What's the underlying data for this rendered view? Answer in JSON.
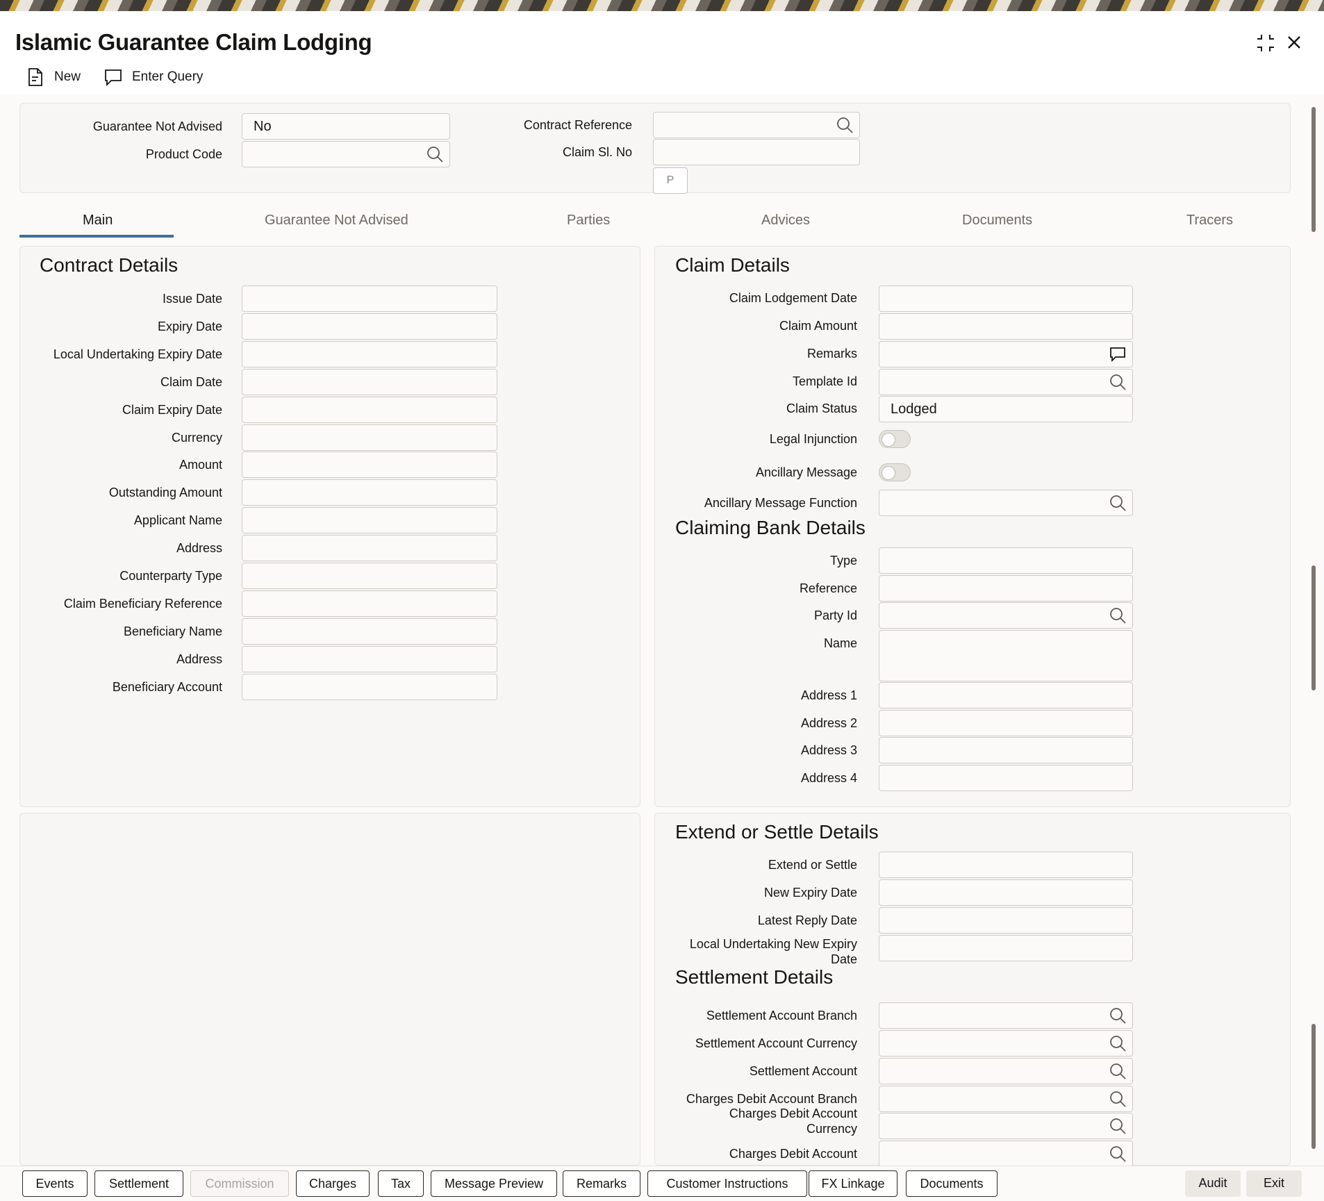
{
  "window": {
    "title": "Islamic Guarantee Claim Lodging"
  },
  "toolbar": {
    "new_label": "New",
    "enter_query_label": "Enter Query"
  },
  "header": {
    "guarantee_not_advised_label": "Guarantee Not Advised",
    "guarantee_not_advised_value": "No",
    "product_code_label": "Product Code",
    "contract_reference_label": "Contract Reference",
    "claim_sl_no_label": "Claim Sl. No",
    "p_button": "P"
  },
  "tabs": [
    "Main",
    "Guarantee Not Advised",
    "Parties",
    "Advices",
    "Documents",
    "Tracers"
  ],
  "contract_details": {
    "title": "Contract Details",
    "fields": [
      "Issue Date",
      "Expiry Date",
      "Local Undertaking Expiry Date",
      "Claim Date",
      "Claim Expiry Date",
      "Currency",
      "Amount",
      "Outstanding Amount",
      "Applicant Name",
      "Address",
      "Counterparty Type",
      "Claim Beneficiary Reference",
      "Beneficiary Name",
      "Address",
      "Beneficiary Account"
    ]
  },
  "claim_details": {
    "title": "Claim Details",
    "claim_lodgement_date": "Claim Lodgement Date",
    "claim_amount": "Claim Amount",
    "remarks": "Remarks",
    "template_id": "Template Id",
    "claim_status": "Claim Status",
    "claim_status_value": "Lodged",
    "legal_injunction": "Legal Injunction",
    "ancillary_message": "Ancillary Message",
    "ancillary_message_function": "Ancillary Message Function"
  },
  "claiming_bank": {
    "title": "Claiming Bank Details",
    "type": "Type",
    "reference": "Reference",
    "party_id": "Party Id",
    "name": "Name",
    "address1": "Address 1",
    "address2": "Address 2",
    "address3": "Address 3",
    "address4": "Address 4"
  },
  "extend_settle": {
    "title": "Extend or Settle Details",
    "extend_or_settle": "Extend or Settle",
    "new_expiry_date": "New Expiry Date",
    "latest_reply_date": "Latest Reply Date",
    "local_undertaking_line1": "Local Undertaking New Expiry",
    "local_undertaking_line2": "Date"
  },
  "settlement": {
    "title": "Settlement Details",
    "account_branch": "Settlement Account Branch",
    "account_currency": "Settlement Account Currency",
    "account": "Settlement Account",
    "charges_branch": "Charges Debit Account Branch",
    "charges_currency_line1": "Charges Debit Account",
    "charges_currency_line2": "Currency",
    "charges_account": "Charges Debit Account"
  },
  "bottom_buttons": [
    "Events",
    "Settlement",
    "Commission",
    "Charges",
    "Tax",
    "Message Preview",
    "Remarks",
    "Customer Instructions",
    "FX Linkage",
    "Documents"
  ],
  "bottom_right": {
    "audit": "Audit",
    "exit": "Exit"
  },
  "icons": [
    "new-document-icon",
    "enter-query-icon",
    "search-icon",
    "comment-icon",
    "maximize-icon",
    "close-icon"
  ],
  "colors": {
    "tab_underline": "#3e6fa3",
    "text": "#161513",
    "muted_text": "#6f6a64",
    "disabled_text": "#a8a29b"
  }
}
